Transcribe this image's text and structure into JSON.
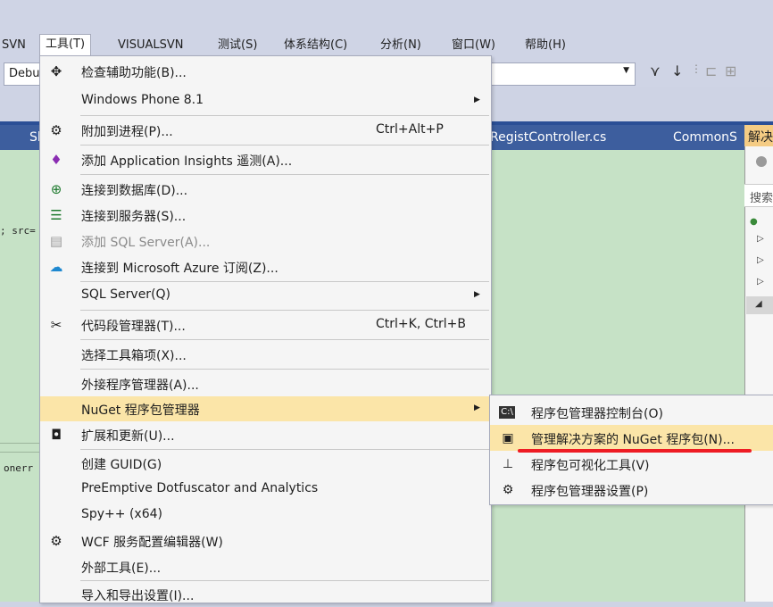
{
  "menubar": {
    "items": [
      "SVN",
      "工具(T)",
      "VISUALSVN",
      "测试(S)",
      "体系结构(C)",
      "分析(N)",
      "窗口(W)",
      "帮助(H)"
    ]
  },
  "toolbar": {
    "config_value": "Debu"
  },
  "tabs": {
    "left_partial": "Sh",
    "regist": "RegistController.cs",
    "common": "CommonS"
  },
  "editor": {
    "frag_src": "; src=",
    "frag_onerr": "onerr"
  },
  "solution_explorer": {
    "header": "解决",
    "search": "搜索"
  },
  "tools_menu": {
    "items": [
      {
        "label": "检查辅助功能(B)...",
        "icon": "accessibility-checker-icon"
      },
      {
        "label": "Windows Phone 8.1",
        "submenu": true
      },
      {
        "label": "附加到进程(P)...",
        "shortcut": "Ctrl+Alt+P",
        "icon": "attach-process-icon"
      },
      {
        "label": "添加 Application Insights 遥测(A)...",
        "icon": "insights-icon"
      },
      {
        "label": "连接到数据库(D)...",
        "icon": "connect-database-icon"
      },
      {
        "label": "连接到服务器(S)...",
        "icon": "connect-server-icon"
      },
      {
        "label": "添加 SQL Server(A)...",
        "icon": "sql-server-icon",
        "disabled": true
      },
      {
        "label": "连接到 Microsoft Azure 订阅(Z)...",
        "icon": "azure-cloud-icon"
      },
      {
        "label": "SQL Server(Q)",
        "submenu": true
      },
      {
        "label": "代码段管理器(T)...",
        "shortcut": "Ctrl+K, Ctrl+B",
        "icon": "snippet-manager-icon"
      },
      {
        "label": "选择工具箱项(X)..."
      },
      {
        "label": "外接程序管理器(A)..."
      },
      {
        "label": "NuGet 程序包管理器",
        "submenu": true,
        "highlighted": true
      },
      {
        "label": "扩展和更新(U)...",
        "icon": "extensions-icon"
      },
      {
        "label": "创建 GUID(G)"
      },
      {
        "label": "PreEmptive Dotfuscator and Analytics"
      },
      {
        "label": "Spy++ (x64)"
      },
      {
        "label": "WCF 服务配置编辑器(W)",
        "icon": "wcf-config-icon"
      },
      {
        "label": "外部工具(E)..."
      },
      {
        "label": "导入和导出设置(I)..."
      }
    ]
  },
  "nuget_submenu": {
    "items": [
      {
        "label": "程序包管理器控制台(O)",
        "icon": "console-icon"
      },
      {
        "label": "管理解决方案的 NuGet 程序包(N)...",
        "icon": "nuget-package-icon",
        "highlighted": true
      },
      {
        "label": "程序包可视化工具(V)",
        "icon": "visualizer-icon"
      },
      {
        "label": "程序包管理器设置(P)",
        "icon": "settings-gear-icon"
      }
    ]
  }
}
